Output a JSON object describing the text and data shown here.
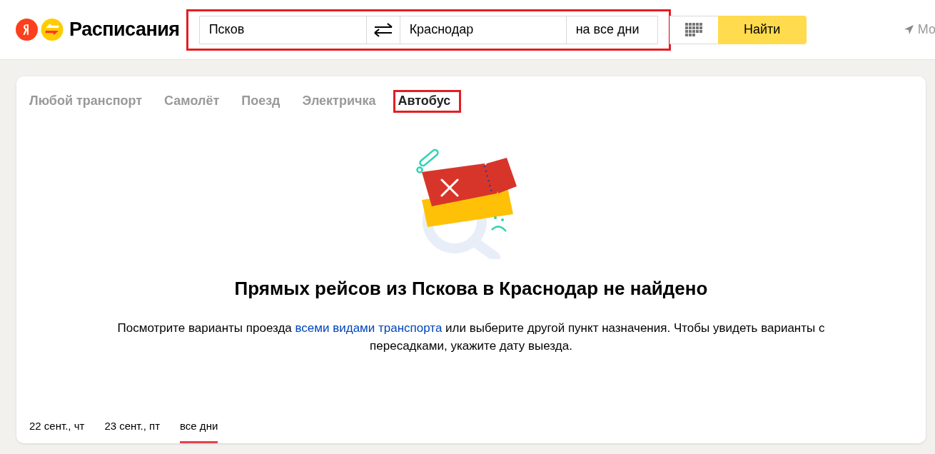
{
  "header": {
    "logo_text": "Расписания",
    "search": {
      "highlighted": true,
      "from": "Псков",
      "to": "Краснодар",
      "date": "на все дни",
      "submit": "Найти"
    },
    "location": "Мо"
  },
  "transport_tabs": [
    {
      "label": "Любой транспорт",
      "selected": false,
      "highlighted": false
    },
    {
      "label": "Самолёт",
      "selected": false,
      "highlighted": false
    },
    {
      "label": "Поезд",
      "selected": false,
      "highlighted": false
    },
    {
      "label": "Электричка",
      "selected": false,
      "highlighted": false
    },
    {
      "label": "Автобус",
      "selected": true,
      "highlighted": true
    }
  ],
  "empty_state": {
    "title": "Прямых рейсов из Пскова в Краснодар не найдено",
    "text_before": "Посмотрите варианты проезда ",
    "link": "всеми видами транспорта",
    "text_after": " или выберите другой пункт назначения. Чтобы увидеть варианты с пересадками, укажите дату выезда."
  },
  "date_tabs": [
    {
      "label": "22 сент., чт",
      "selected": false
    },
    {
      "label": "23 сент., пт",
      "selected": false
    },
    {
      "label": "все дни",
      "selected": true
    }
  ]
}
